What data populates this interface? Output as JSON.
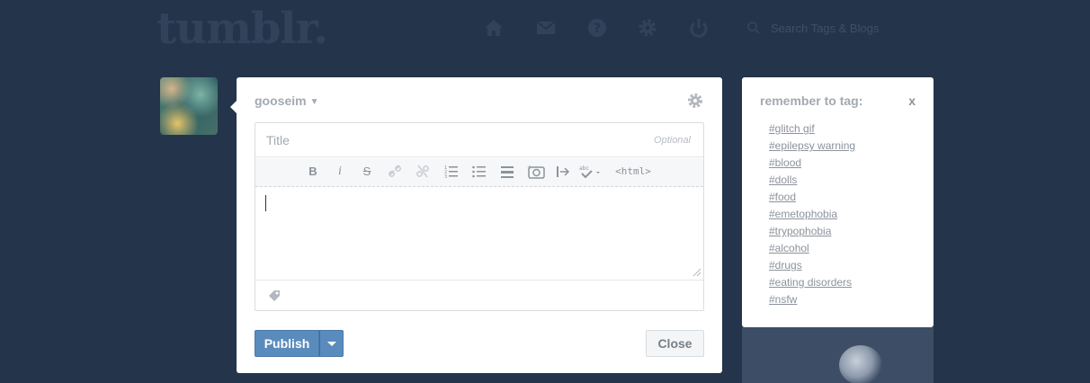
{
  "header": {
    "logo_text": "tumblr.",
    "nav_icons": [
      "home-icon",
      "mail-icon",
      "help-icon",
      "gear-icon",
      "power-icon"
    ],
    "search_placeholder": "Search Tags & Blogs"
  },
  "post": {
    "blog_name": "gooseim",
    "title_placeholder": "Title",
    "title_optional": "Optional",
    "toolbar": {
      "bold": "B",
      "italic": "i",
      "strike": "S",
      "html": "<html>"
    },
    "publish_label": "Publish",
    "close_label": "Close"
  },
  "reminder": {
    "title": "remember to tag:",
    "close": "x",
    "tags": [
      "#glitch gif",
      "#epilepsy warning",
      "#blood",
      "#dolls",
      "#food",
      "#emetophobia",
      "#trypophobia",
      "#alcohol",
      "#drugs",
      "#eating disorders",
      "#nsfw"
    ]
  },
  "colors": {
    "background": "#24344b",
    "publish": "#5a8bbd"
  }
}
